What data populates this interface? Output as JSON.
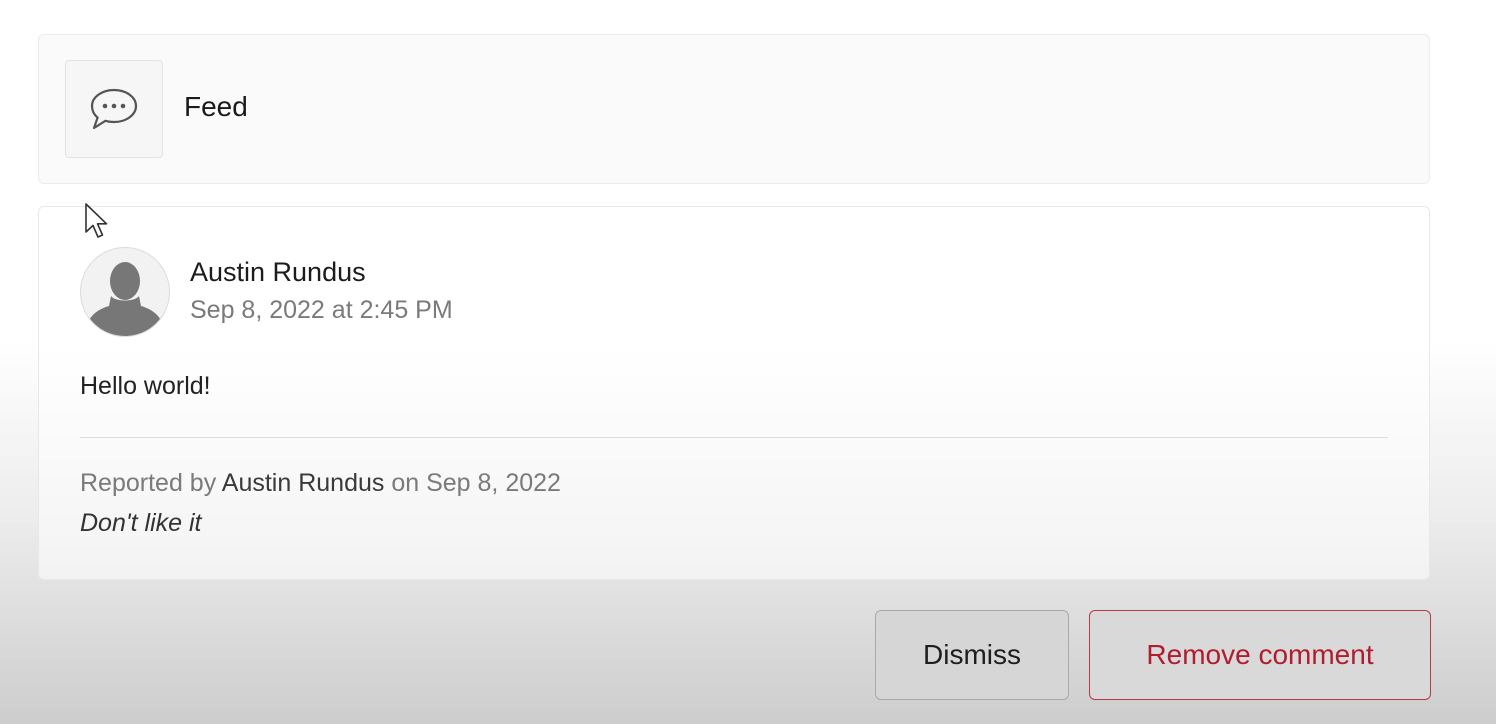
{
  "feed": {
    "title": "Feed",
    "icon": "speech-bubble-icon"
  },
  "comment": {
    "author": "Austin Rundus",
    "timestamp": "Sep 8, 2022 at 2:45 PM",
    "body": "Hello world!",
    "avatar_icon": "default-avatar-icon"
  },
  "report": {
    "prefix": "Reported by",
    "reporter": "Austin Rundus",
    "date_text": "on Sep 8, 2022",
    "reason": "Don't like it"
  },
  "actions": {
    "dismiss_label": "Dismiss",
    "remove_label": "Remove comment"
  },
  "colors": {
    "danger": "#b01d2e",
    "danger_border": "#b53a4a"
  }
}
